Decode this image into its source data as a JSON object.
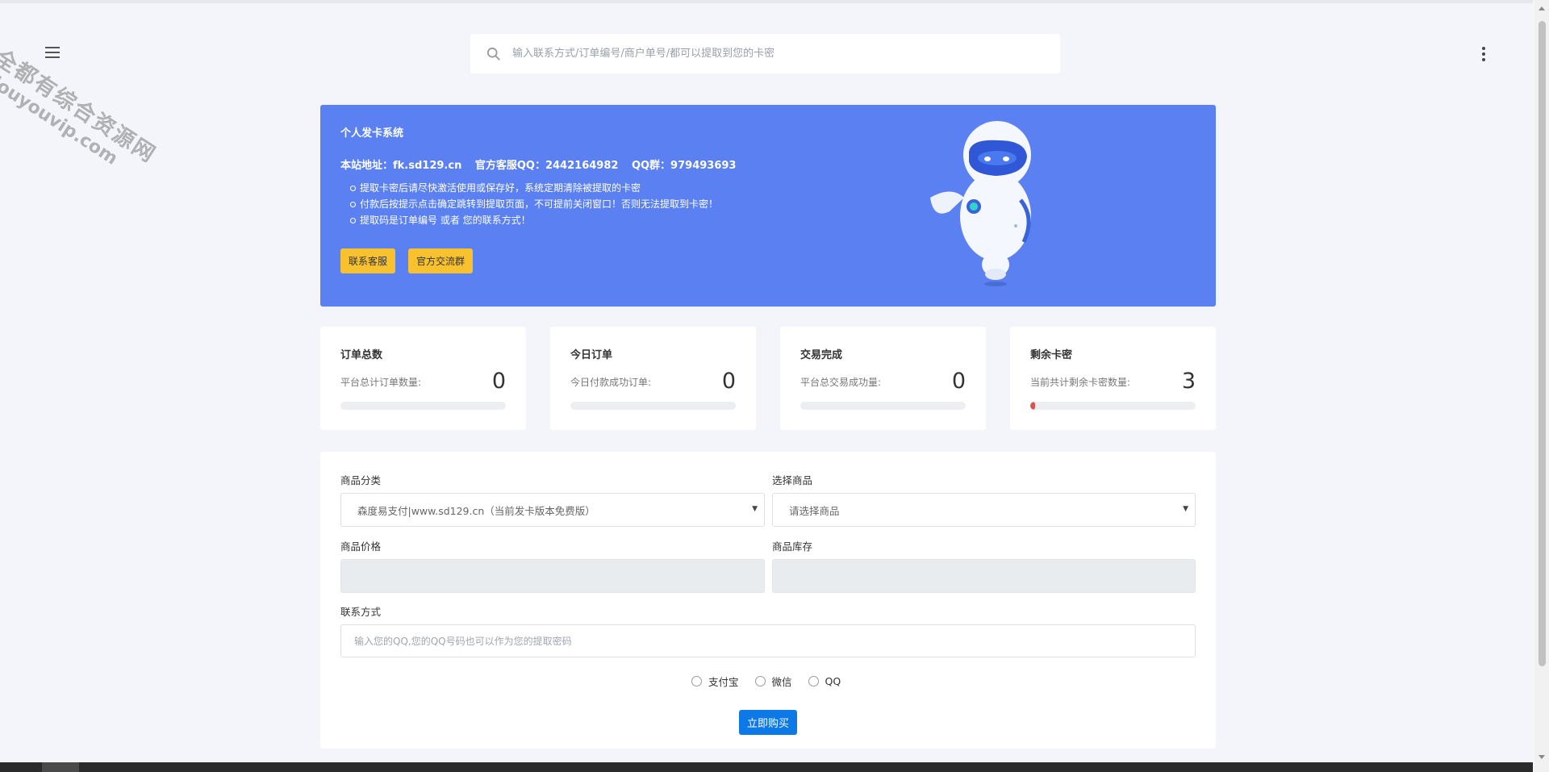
{
  "header": {
    "search_placeholder": "输入联系方式/订单编号/商户单号/都可以提取到您的卡密"
  },
  "watermark": {
    "line1": "全都有综合资源网",
    "line2": "douyouvip.com"
  },
  "hero": {
    "title": "个人发卡系统",
    "site_address": "本站地址：fk.sd129.cn",
    "support_qq": "官方客服QQ：2442164982",
    "qq_group": "QQ群：979493693",
    "notices": [
      "提取卡密后请尽快激活使用或保存好，系统定期清除被提取的卡密",
      "付款后按提示点击确定跳转到提取页面，不可提前关闭窗口！否则无法提取到卡密！",
      "提取码是订单编号 或者 您的联系方式！"
    ],
    "buttons": {
      "contact": "联系客服",
      "group": "官方交流群"
    },
    "button_color": "#f7c12f",
    "bg_color": "#5a80f2"
  },
  "stats": [
    {
      "title": "订单总数",
      "label": "平台总计订单数量:",
      "value": "0",
      "progress": 0
    },
    {
      "title": "今日订单",
      "label": "今日付款成功订单:",
      "value": "0",
      "progress": 0
    },
    {
      "title": "交易完成",
      "label": "平台总交易成功量:",
      "value": "0",
      "progress": 0
    },
    {
      "title": "剩余卡密",
      "label": "当前共计剩余卡密数量:",
      "value": "3",
      "progress": 0.02
    }
  ],
  "form": {
    "category_label": "商品分类",
    "category_value": "森度易支付|www.sd129.cn（当前发卡版本免费版）",
    "product_label": "选择商品",
    "product_value": "请选择商品",
    "price_label": "商品价格",
    "stock_label": "商品库存",
    "contact_label": "联系方式",
    "contact_placeholder": "输入您的QQ,您的QQ号码也可以作为您的提取密码",
    "payment_options": [
      "支付宝",
      "微信",
      "QQ"
    ],
    "buy_button": "立即购买",
    "buy_color": "#0d79e6"
  }
}
